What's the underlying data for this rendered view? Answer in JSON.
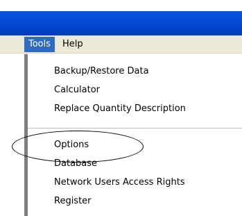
{
  "menubar": {
    "items": [
      {
        "label": "Tools",
        "active": true
      },
      {
        "label": "Help",
        "active": false
      }
    ]
  },
  "tools_menu": {
    "group1": [
      {
        "label": "Backup/Restore Data"
      },
      {
        "label": "Calculator"
      },
      {
        "label": "Replace Quantity Description"
      }
    ],
    "group2": [
      {
        "label": "Options",
        "highlighted_by_circle": true
      },
      {
        "label": "Database"
      },
      {
        "label": "Network Users Access Rights"
      },
      {
        "label": "Register"
      }
    ]
  },
  "colors": {
    "titlebar": "#0553dc",
    "menu_highlight": "#316ac5",
    "menubar_bg": "#ece9d8"
  }
}
